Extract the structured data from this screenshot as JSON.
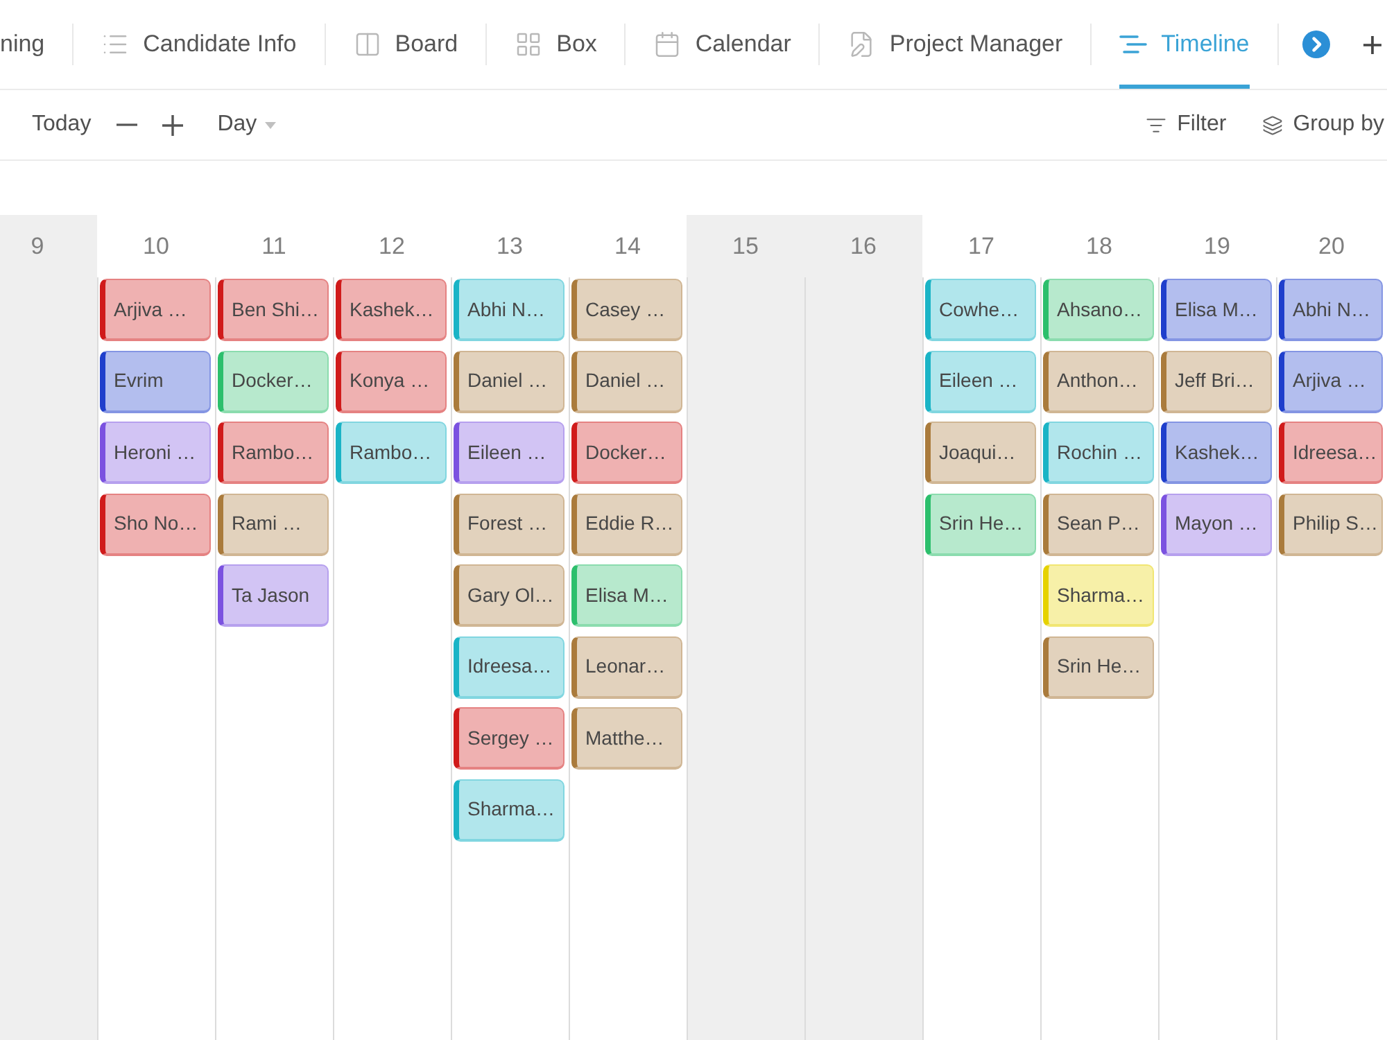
{
  "tabs": [
    {
      "label": "ning",
      "selected": false
    },
    {
      "label": "Candidate Info",
      "selected": false
    },
    {
      "label": "Board",
      "selected": false
    },
    {
      "label": "Box",
      "selected": false
    },
    {
      "label": "Calendar",
      "selected": false
    },
    {
      "label": "Project Manager",
      "selected": false
    },
    {
      "label": "Timeline",
      "selected": true
    }
  ],
  "toolbar": {
    "today": "Today",
    "scale": "Day",
    "filter": "Filter",
    "group_by": "Group by"
  },
  "timeline": {
    "columns": [
      {
        "day": "9",
        "shaded": true
      },
      {
        "day": "10",
        "shaded": false,
        "cards": [
          {
            "label": "Arjiva …",
            "color": "#d01b1b"
          },
          {
            "label": "Evrim",
            "color": "#1f3fcc"
          },
          {
            "label": "Heroni …",
            "color": "#7b52e0"
          },
          {
            "label": "Sho No…",
            "color": "#d01b1b"
          }
        ]
      },
      {
        "day": "11",
        "shaded": false,
        "cards": [
          {
            "label": "Ben Shi…",
            "color": "#d01b1b"
          },
          {
            "label": "Docker…",
            "color": "#2cbf6c"
          },
          {
            "label": "Rambo…",
            "color": "#d01b1b"
          },
          {
            "label": "Rami …",
            "color": "#aa7b3c"
          },
          {
            "label": "Ta Jason",
            "color": "#7b52e0"
          }
        ]
      },
      {
        "day": "12",
        "shaded": false,
        "cards": [
          {
            "label": "Kashek…",
            "color": "#d01b1b"
          },
          {
            "label": "Konya …",
            "color": "#d01b1b"
          },
          {
            "label": "Rambo…",
            "color": "#1ab4c6"
          }
        ]
      },
      {
        "day": "13",
        "shaded": false,
        "cards": [
          {
            "label": "Abhi N…",
            "color": "#1ab4c6"
          },
          {
            "label": "Daniel …",
            "color": "#aa7b3c"
          },
          {
            "label": "Eileen …",
            "color": "#7b52e0"
          },
          {
            "label": "Forest …",
            "color": "#aa7b3c"
          },
          {
            "label": "Gary Ol…",
            "color": "#aa7b3c"
          },
          {
            "label": "Idreesa…",
            "color": "#1ab4c6"
          },
          {
            "label": "Sergey …",
            "color": "#d01b1b"
          },
          {
            "label": "Sharma…",
            "color": "#1ab4c6"
          }
        ]
      },
      {
        "day": "14",
        "shaded": false,
        "cards": [
          {
            "label": "Casey …",
            "color": "#aa7b3c"
          },
          {
            "label": "Daniel …",
            "color": "#aa7b3c"
          },
          {
            "label": "Docker…",
            "color": "#d01b1b"
          },
          {
            "label": "Eddie R…",
            "color": "#aa7b3c"
          },
          {
            "label": "Elisa M…",
            "color": "#2cbf6c"
          },
          {
            "label": "Leonar…",
            "color": "#aa7b3c"
          },
          {
            "label": "Matthe…",
            "color": "#aa7b3c"
          }
        ]
      },
      {
        "day": "15",
        "shaded": true
      },
      {
        "day": "16",
        "shaded": true
      },
      {
        "day": "17",
        "shaded": false,
        "cards": [
          {
            "label": "Cowhe…",
            "color": "#1ab4c6"
          },
          {
            "label": "Eileen …",
            "color": "#1ab4c6"
          },
          {
            "label": "Joaqui…",
            "color": "#aa7b3c"
          },
          {
            "label": "Srin He…",
            "color": "#2cbf6c"
          }
        ]
      },
      {
        "day": "18",
        "shaded": false,
        "cards": [
          {
            "label": "Ahsano…",
            "color": "#2cbf6c"
          },
          {
            "label": "Anthon…",
            "color": "#aa7b3c"
          },
          {
            "label": "Rochin …",
            "color": "#1ab4c6"
          },
          {
            "label": "Sean P…",
            "color": "#aa7b3c"
          },
          {
            "label": "Sharma…",
            "color": "#e6d200"
          },
          {
            "label": "Srin He…",
            "color": "#aa7b3c"
          }
        ]
      },
      {
        "day": "19",
        "shaded": false,
        "cards": [
          {
            "label": "Elisa M…",
            "color": "#1f3fcc"
          },
          {
            "label": "Jeff Bri…",
            "color": "#aa7b3c"
          },
          {
            "label": "Kashek…",
            "color": "#1f3fcc"
          },
          {
            "label": "Mayon …",
            "color": "#7b52e0"
          }
        ]
      },
      {
        "day": "20",
        "shaded": false,
        "cards": [
          {
            "label": "Abhi N…",
            "color": "#1f3fcc"
          },
          {
            "label": "Arjiva …",
            "color": "#1f3fcc"
          },
          {
            "label": "Idreesa…",
            "color": "#d01b1b"
          },
          {
            "label": "Philip S…",
            "color": "#aa7b3c"
          }
        ]
      }
    ]
  }
}
